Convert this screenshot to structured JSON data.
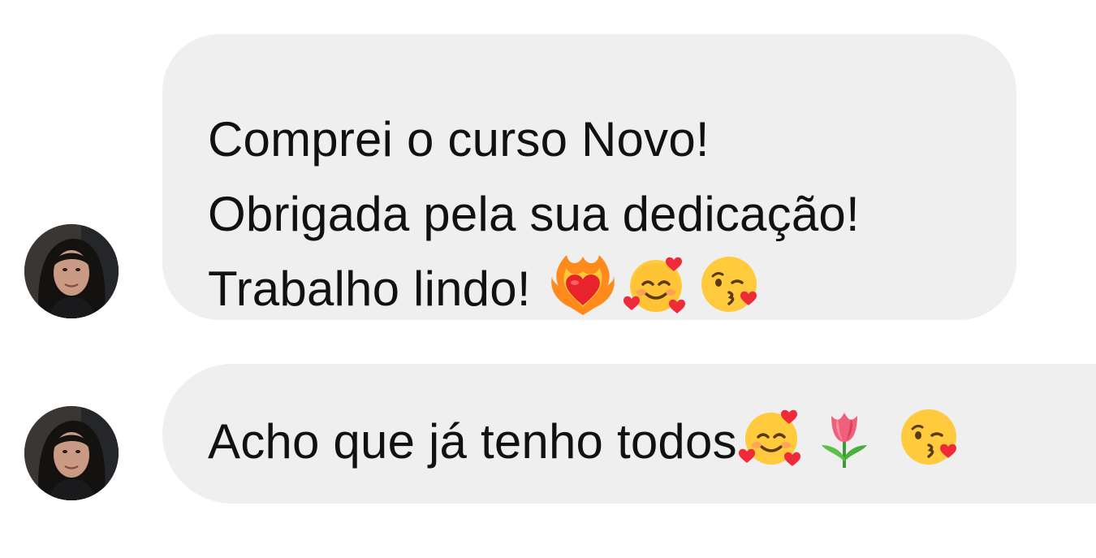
{
  "messages": [
    {
      "lines": [
        {
          "text": "Comprei o curso Novo!",
          "emojis": []
        },
        {
          "text": "Obrigada pela sua dedicação!",
          "emojis": []
        },
        {
          "text": "Trabalho lindo!",
          "emojis": [
            "heart-on-fire-emoji",
            "smiling-face-with-hearts-emoji",
            "face-blowing-kiss-emoji"
          ]
        }
      ]
    },
    {
      "lines": [
        {
          "text": "Acho que já tenho todos",
          "emojis": [
            "smiling-face-with-hearts-emoji",
            "tulip-emoji",
            "face-blowing-kiss-emoji"
          ]
        }
      ]
    }
  ],
  "colors": {
    "bubble": "#efefef",
    "text": "#111111",
    "background": "#ffffff"
  }
}
